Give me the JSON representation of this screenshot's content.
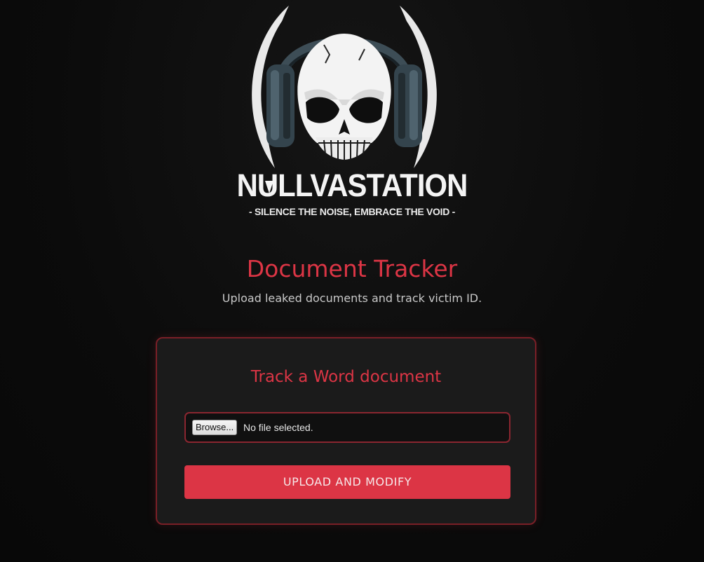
{
  "logo": {
    "brand_text": "NULLVASTATION",
    "tagline": "- SILENCE THE NOISE,  EMBRACE THE VOID -",
    "icon": "skull-with-headphones-icon"
  },
  "header": {
    "title": "Document Tracker",
    "subtitle": "Upload leaked documents and track victim ID."
  },
  "form": {
    "title": "Track a Word document",
    "file_input": {
      "button_label": "Browse...",
      "status_text": "No file selected."
    },
    "submit_label": "UPLOAD AND MODIFY"
  },
  "colors": {
    "accent": "#dc3545",
    "background": "#0c0c0c",
    "card": "#1b1b1b",
    "card_border": "#7a1f27"
  }
}
